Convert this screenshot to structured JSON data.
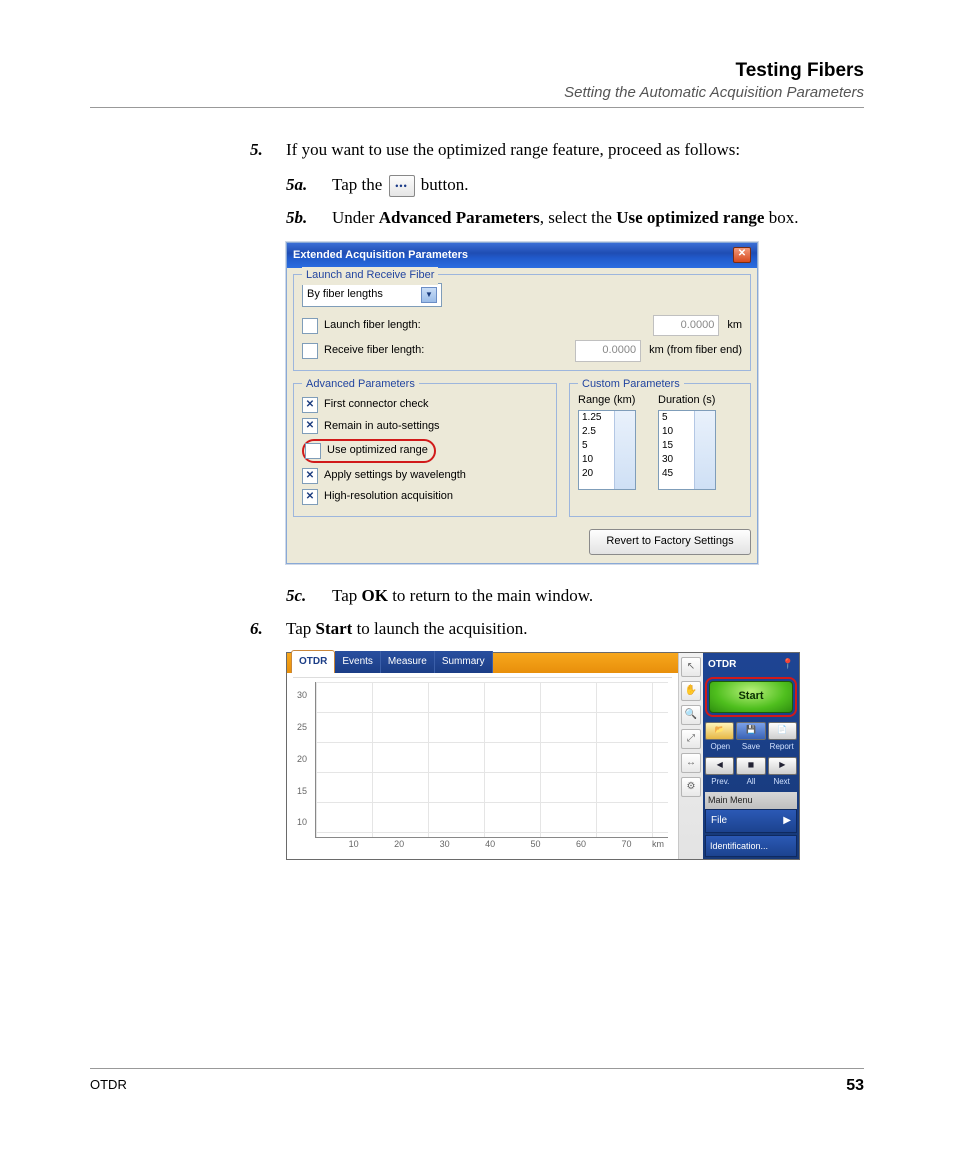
{
  "header": {
    "title": "Testing Fibers",
    "subtitle": "Setting the Automatic Acquisition Parameters"
  },
  "steps": {
    "s5": {
      "num": "5.",
      "text": "If you want to use the optimized range feature, proceed as follows:",
      "a": {
        "num": "5a.",
        "pre": "Tap the ",
        "post": " button."
      },
      "b": {
        "num": "5b.",
        "pre": "Under ",
        "b1": "Advanced Parameters",
        "mid": ", select the ",
        "b2": "Use optimized range",
        "post": " box."
      },
      "c": {
        "num": "5c.",
        "pre": "Tap ",
        "b1": "OK",
        "post": " to return to the main window."
      }
    },
    "s6": {
      "num": "6.",
      "pre": "Tap ",
      "b1": "Start",
      "post": " to launch the acquisition."
    }
  },
  "dialog": {
    "title": "Extended Acquisition Parameters",
    "group_launch": "Launch and Receive Fiber",
    "dropdown": "By fiber lengths",
    "launch_label": "Launch fiber length:",
    "receive_label": "Receive fiber length:",
    "val": "0.0000",
    "unit_km": "km",
    "unit_recv": "km (from fiber end)",
    "group_adv": "Advanced Parameters",
    "c1": "First connector check",
    "c2": "Remain in auto-settings",
    "c3": "Use optimized range",
    "c4": "Apply settings by wavelength",
    "c5": "High-resolution acquisition",
    "group_custom": "Custom Parameters",
    "range_hdr": "Range (km)",
    "duration_hdr": "Duration (s)",
    "range_vals": [
      "1.25",
      "2.5",
      "5",
      "10",
      "20"
    ],
    "duration_vals": [
      "5",
      "10",
      "15",
      "30",
      "45"
    ],
    "revert": "Revert to Factory Settings"
  },
  "otdr": {
    "panel_title": "OTDR",
    "tabs": {
      "t1": "OTDR",
      "t2": "Events",
      "t3": "Measure",
      "t4": "Summary"
    },
    "start": "Start",
    "row1": {
      "a": "Open",
      "b": "Save",
      "c": "Report"
    },
    "row2": {
      "a": "Prev.",
      "b": "All",
      "c": "Next"
    },
    "mainmenu": "Main Menu",
    "file": "File",
    "ident": "Identification...",
    "yticks": [
      "30",
      "25",
      "20",
      "15",
      "10"
    ],
    "xticks": [
      "10",
      "20",
      "30",
      "40",
      "50",
      "60",
      "70"
    ],
    "xunit": "km"
  },
  "footer": {
    "left": "OTDR",
    "page": "53"
  }
}
